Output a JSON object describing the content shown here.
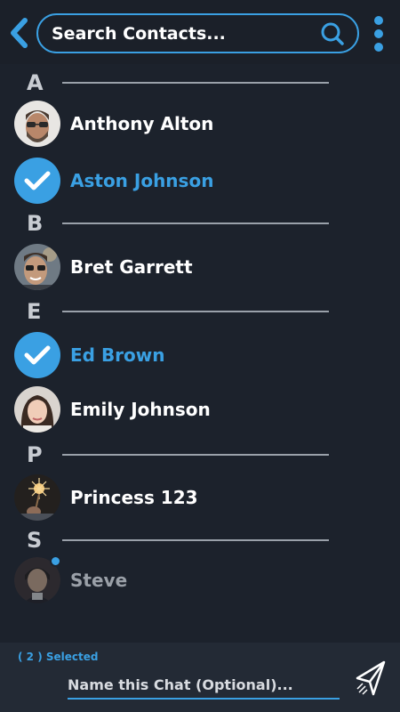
{
  "header": {
    "search_placeholder": "Search Contacts...",
    "accent_color": "#3aa0e3"
  },
  "icons": {
    "back": "back-arrow-icon",
    "search": "search-icon",
    "menu": "more-vertical-icon",
    "check": "checkmark-icon",
    "send": "send-icon"
  },
  "sections": [
    {
      "letter": "A"
    },
    {
      "letter": "B"
    },
    {
      "letter": "E"
    },
    {
      "letter": "P"
    },
    {
      "letter": "S"
    }
  ],
  "contacts": [
    {
      "name": "Anthony Alton",
      "state": "normal"
    },
    {
      "name": "Aston Johnson",
      "state": "selected"
    },
    {
      "name": "Bret Garrett",
      "state": "normal"
    },
    {
      "name": "Ed Brown",
      "state": "selected"
    },
    {
      "name": "Emily Johnson",
      "state": "normal"
    },
    {
      "name": "Princess 123",
      "state": "normal"
    },
    {
      "name": "Steve",
      "state": "offline"
    }
  ],
  "footer": {
    "selected_label": "( 2 ) Selected",
    "chat_name_placeholder": "Name this Chat (Optional)..."
  }
}
